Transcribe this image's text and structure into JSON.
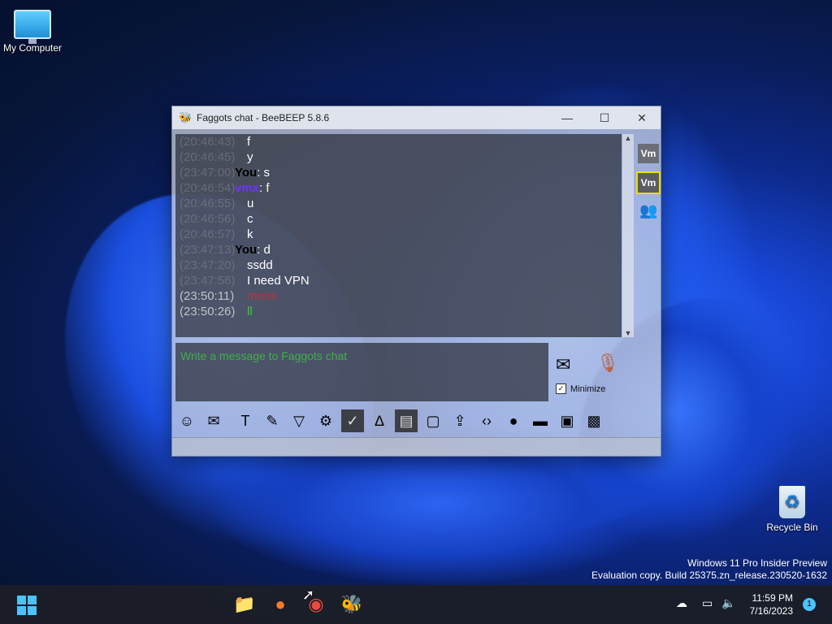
{
  "desktop": {
    "my_computer_label": "My Computer",
    "recycle_bin_label": "Recycle Bin",
    "watermark_line1": "Windows 11 Pro Insider Preview",
    "watermark_line2": "Evaluation copy. Build 25375.zn_release.230520-1632"
  },
  "window": {
    "title": "Faggots chat - BeeBEEP 5.8.6",
    "minimize_glyph": "—",
    "maximize_glyph": "☐",
    "close_glyph": "✕"
  },
  "chat": {
    "messages": [
      {
        "ts": "(20:46:43)",
        "who": "",
        "text": "f"
      },
      {
        "ts": "(20:46:45)",
        "who": "",
        "text": "y"
      },
      {
        "ts": "(23:47:00)",
        "who": "You",
        "text": ": s"
      },
      {
        "ts": "(20:46:54)",
        "who": "vmx",
        "text": ": f"
      },
      {
        "ts": "(20:46:55)",
        "who": "",
        "text": "u"
      },
      {
        "ts": "(20:46:56)",
        "who": "",
        "text": "c"
      },
      {
        "ts": "(20:46:57)",
        "who": "",
        "text": "k"
      },
      {
        "ts": "(23:47:13)",
        "who": "You",
        "text": ": d"
      },
      {
        "ts": "(23:47:20)",
        "who": "",
        "text": "ssdd"
      },
      {
        "ts": "(23:47:56)",
        "who": "",
        "text": "I need VPN"
      },
      {
        "ts": "(23:50:11)",
        "who": "",
        "text": "mmm"
      },
      {
        "ts": "(23:50:26)",
        "who": "",
        "text": "ll"
      }
    ]
  },
  "side": {
    "vm1": "Vm",
    "vm2": "Vm"
  },
  "input": {
    "placeholder": "Write a message to Faggots chat",
    "minimize_label": "Minimize",
    "minimize_checked": "✓"
  },
  "colors": {
    "accent_green": "#3fb04a",
    "msg_red": "#c0303a",
    "msg_green": "#3ecb3e"
  },
  "taskbar": {
    "time": "11:59 PM",
    "date": "7/16/2023",
    "notification_count": "1"
  }
}
